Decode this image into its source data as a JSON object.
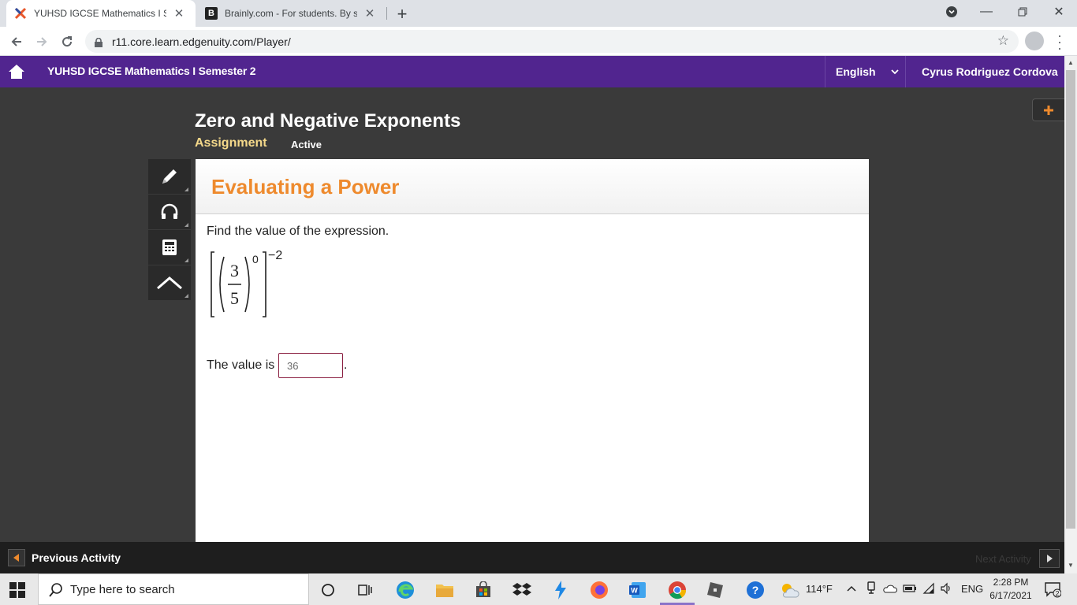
{
  "browser": {
    "tabs": [
      {
        "title": "YUHSD IGCSE Mathematics I Semester 2",
        "active": true
      },
      {
        "title": "Brainly.com - For students. By students.",
        "active": false
      }
    ],
    "url": "r11.core.learn.edgenuity.com/Player/"
  },
  "course": {
    "title": "YUHSD IGCSE Mathematics I Semester 2",
    "language": "English",
    "user": "Cyrus Rodriguez Cordova"
  },
  "lesson": {
    "title": "Zero and Negative Exponents",
    "type": "Assignment",
    "status": "Active"
  },
  "question": {
    "heading": "Evaluating a Power",
    "prompt": "Find the value of the expression.",
    "expression": {
      "numerator": "3",
      "denominator": "5",
      "inner_exponent": "0",
      "outer_exponent": "−2"
    },
    "answer_label": "The value is",
    "answer_value": "36",
    "answer_suffix": "."
  },
  "nav": {
    "previous": "Previous Activity",
    "next": "Next Activity"
  },
  "taskbar": {
    "search_placeholder": "Type here to search",
    "weather": "114°F",
    "language": "ENG",
    "time": "2:28 PM",
    "date": "6/17/2021",
    "notifications": "2"
  },
  "colors": {
    "course_bar": "#51258f",
    "heading_orange": "#ee8a2d",
    "assignment_yellow": "#f5d98a",
    "page_bg": "#3a3a3a"
  }
}
